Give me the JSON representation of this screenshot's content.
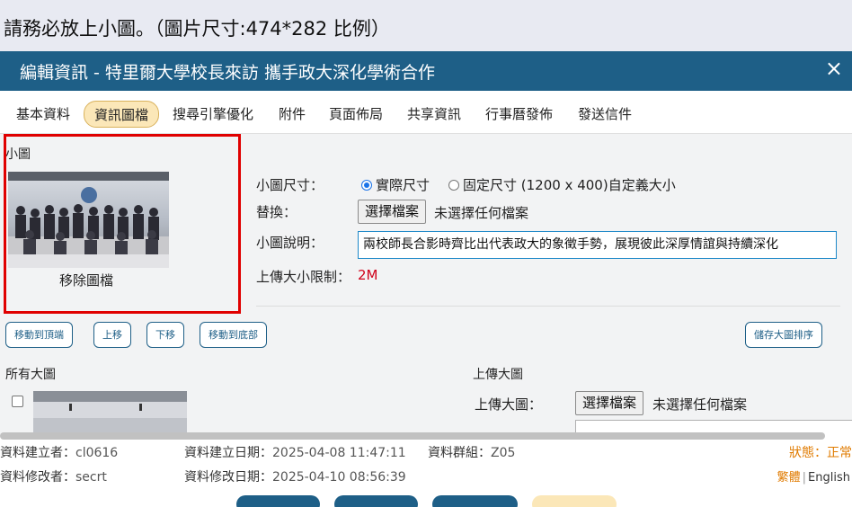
{
  "instruction": "請務必放上小圖。（圖片尺寸:474*282 比例）",
  "dialog": {
    "title": "編輯資訊 - 特里爾大學校長來訪 攜手政大深化學術合作",
    "close": "×"
  },
  "tabs": [
    {
      "label": "基本資料",
      "active": false
    },
    {
      "label": "資訊圖檔",
      "active": true
    },
    {
      "label": "搜尋引擎優化",
      "active": false
    },
    {
      "label": "附件",
      "active": false
    },
    {
      "label": "頁面佈局",
      "active": false
    },
    {
      "label": "共享資訊",
      "active": false
    },
    {
      "label": "行事曆發佈",
      "active": false
    },
    {
      "label": "發送信件",
      "active": false
    }
  ],
  "small_image": {
    "section_label": "小圖",
    "remove_label": "移除圖檔",
    "size_label": "小圖尺寸：",
    "size_option_actual": "實際尺寸",
    "size_option_fixed": "固定尺寸 (1200 x 400)自定義大小",
    "replace_label": "替換：",
    "choose_file": "選擇檔案",
    "no_file": "未選擇任何檔案",
    "desc_label": "小圖說明：",
    "desc_value": "兩校師長合影時齊比出代表政大的象徵手勢，展現彼此深厚情誼與持續深化",
    "upload_limit_label": "上傳大小限制：",
    "upload_limit_value": "2M",
    "highlight_color": "#e00000"
  },
  "order_buttons": {
    "top": "移動到頂端",
    "up": "上移",
    "down": "下移",
    "bottom": "移動到底部",
    "save_order": "儲存大圖排序"
  },
  "large_images": {
    "all_label": "所有大圖",
    "upload_section": "上傳大圖",
    "upload_label": "上傳大圖：",
    "choose_file": "選擇檔案",
    "no_file": "未選擇任何檔案"
  },
  "footer": {
    "creator_label": "資料建立者：",
    "creator": "cl0616",
    "created_label": "資料建立日期：",
    "created": "2025-04-08 11:47:11",
    "group_label": "資料群組：",
    "group": "Z05",
    "modifier_label": "資料修改者：",
    "modifier": "secrt",
    "modified_label": "資料修改日期：",
    "modified": "2025-04-10 08:56:39",
    "status": "狀態：正常",
    "lang_trad": "繁體",
    "lang_sep": "|",
    "lang_en": "English"
  },
  "colors": {
    "header": "#1e5f87",
    "active_tab": "#fbe7b8",
    "status": "#e07b00",
    "limit": "#d0021b"
  }
}
